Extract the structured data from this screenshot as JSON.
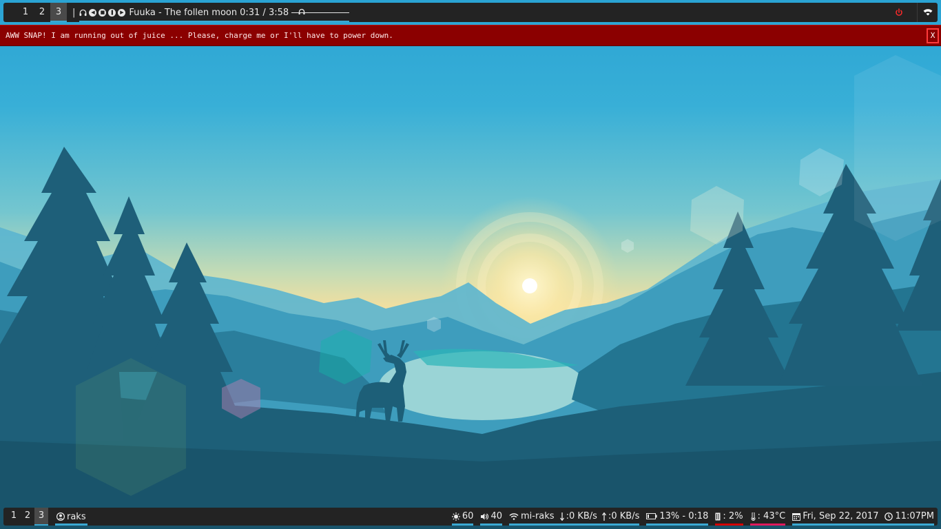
{
  "top_bar": {
    "workspaces": [
      {
        "label": "1",
        "active": false
      },
      {
        "label": "2",
        "active": false
      },
      {
        "label": "3",
        "active": true
      }
    ],
    "separator": "|",
    "music": {
      "icons": [
        "headphones-icon",
        "previous-icon",
        "stop-icon",
        "pause-icon",
        "next-icon"
      ],
      "track": "Fuuka - The follen moon",
      "time": "0:31 / 3:58",
      "progress": 0.13
    },
    "power_icon": "power-icon",
    "tray_icon": "wifi-icon"
  },
  "notification": {
    "text": "AWW SNAP! I am running out of juice ... Please, charge me or I'll have to power down.",
    "close_label": "X",
    "background": "#8b0000",
    "border": "#ff3b3b"
  },
  "bottom_bar": {
    "workspaces": [
      {
        "label": "1",
        "active": false
      },
      {
        "label": "2",
        "active": false
      },
      {
        "label": "3",
        "active": true
      }
    ],
    "user": "raks",
    "brightness": "60",
    "volume": "40",
    "wifi_ssid": "mi-raks",
    "down_speed": ":0 KB/s",
    "up_speed": ":0 KB/s",
    "battery": "13% -  0:18",
    "memory": ": 2%",
    "temperature": ": 43°C",
    "date": "Fri, Sep 22, 2017",
    "time": "11:07PM"
  },
  "colors": {
    "bar_bg": "#232323",
    "accent": "#3aa9d3",
    "warning_red": "#d50000",
    "temp_pink": "#e0195d"
  }
}
